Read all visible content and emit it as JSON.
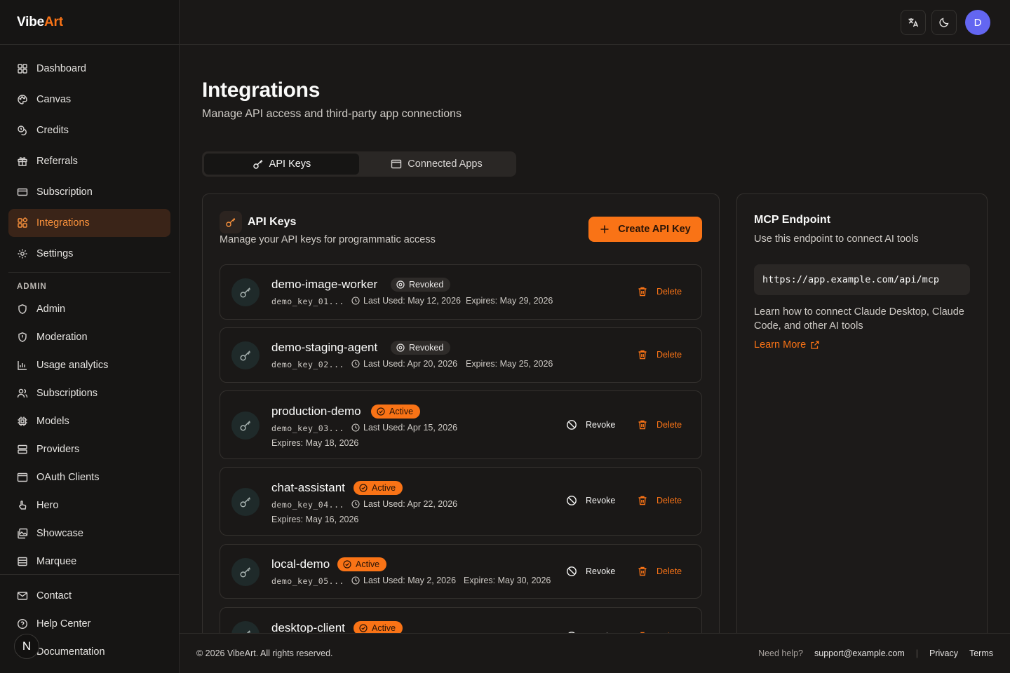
{
  "brand": {
    "part1": "Vibe",
    "part2": "Art"
  },
  "sidebar": {
    "items": [
      {
        "label": "Dashboard",
        "icon": "dashboard-icon"
      },
      {
        "label": "Canvas",
        "icon": "palette-icon"
      },
      {
        "label": "Credits",
        "icon": "coins-icon"
      },
      {
        "label": "Referrals",
        "icon": "gift-icon"
      },
      {
        "label": "Subscription",
        "icon": "credit-card-icon"
      },
      {
        "label": "Integrations",
        "icon": "blocks-icon",
        "active": true
      },
      {
        "label": "Settings",
        "icon": "gear-icon"
      }
    ],
    "admin_heading": "ADMIN",
    "admin_items": [
      {
        "label": "Admin",
        "icon": "shield-icon"
      },
      {
        "label": "Moderation",
        "icon": "shield-alert-icon"
      },
      {
        "label": "Usage analytics",
        "icon": "bar-chart-icon"
      },
      {
        "label": "Subscriptions",
        "icon": "users-icon"
      },
      {
        "label": "Models",
        "icon": "cpu-icon"
      },
      {
        "label": "Providers",
        "icon": "server-icon"
      },
      {
        "label": "OAuth Clients",
        "icon": "app-window-icon"
      },
      {
        "label": "Hero",
        "icon": "hand-pointer-icon"
      },
      {
        "label": "Showcase",
        "icon": "images-icon"
      },
      {
        "label": "Marquee",
        "icon": "list-icon"
      }
    ],
    "bottom_items": [
      {
        "label": "Contact",
        "icon": "mail-icon"
      },
      {
        "label": "Help Center",
        "icon": "help-circle-icon"
      },
      {
        "label": "Documentation",
        "icon": "book-icon"
      }
    ],
    "floating_badge": "N"
  },
  "header": {
    "translate_icon": "translate-icon",
    "theme_icon": "moon-icon",
    "avatar_initial": "D"
  },
  "page": {
    "title": "Integrations",
    "subtitle": "Manage API access and third-party app connections",
    "tabs": [
      {
        "label": "API Keys",
        "icon": "key-icon",
        "active": true
      },
      {
        "label": "Connected Apps",
        "icon": "app-window-icon",
        "active": false
      }
    ]
  },
  "api_keys": {
    "title": "API Keys",
    "subtitle": "Manage your API keys for programmatic access",
    "create_label": "Create API Key",
    "revoke_label": "Revoke",
    "delete_label": "Delete",
    "keys": [
      {
        "name": "demo-image-worker",
        "status": "Revoked",
        "code": "demo_key_01...",
        "last_used": "Last Used: May 12, 2026",
        "expires": "Expires: May 29, 2026"
      },
      {
        "name": "demo-staging-agent",
        "status": "Revoked",
        "code": "demo_key_02...",
        "last_used": "Last Used: Apr 20, 2026",
        "expires": "Expires: May 25, 2026"
      },
      {
        "name": "production-demo",
        "status": "Active",
        "code": "demo_key_03...",
        "last_used": "Last Used: Apr 15, 2026",
        "expires": "Expires: May 18, 2026"
      },
      {
        "name": "chat-assistant",
        "status": "Active",
        "code": "demo_key_04...",
        "last_used": "Last Used: Apr 22, 2026",
        "expires": "Expires: May 16, 2026"
      },
      {
        "name": "local-demo",
        "status": "Active",
        "code": "demo_key_05...",
        "last_used": "Last Used: May 2, 2026",
        "expires": "Expires: May 30, 2026"
      },
      {
        "name": "desktop-client",
        "status": "Active"
      }
    ]
  },
  "mcp": {
    "title": "MCP Endpoint",
    "subtitle": "Use this endpoint to connect AI tools",
    "url": "https://app.example.com/api/mcp",
    "note": "Learn how to connect Claude Desktop, Claude Code, and other AI tools",
    "learn_more": "Learn More"
  },
  "footer": {
    "copyright": "© 2026 VibeArt. All rights reserved.",
    "need_help": "Need help?",
    "email": "support@example.com",
    "separator": "|",
    "privacy": "Privacy",
    "terms": "Terms"
  },
  "colors": {
    "accent": "#f97316",
    "background": "#1a1817",
    "avatar": "#6366f1"
  }
}
